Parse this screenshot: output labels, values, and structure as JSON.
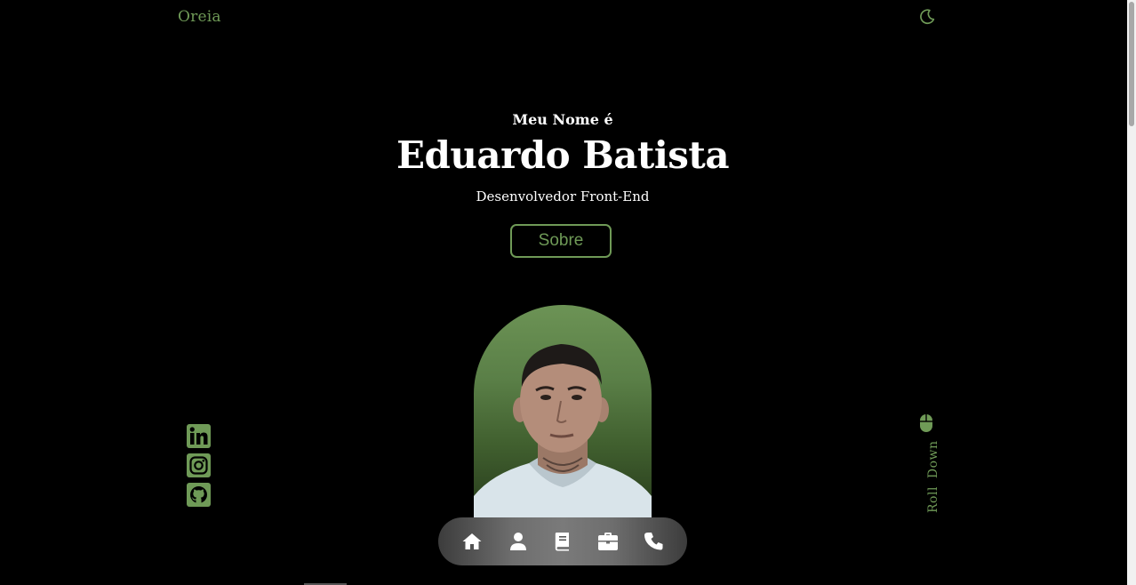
{
  "header": {
    "logo": "Oreia",
    "theme_icon": "moon-icon"
  },
  "hero": {
    "greeting": "Meu Nome é",
    "name": "Eduardo Batista",
    "role": "Desenvolvedor Front-End",
    "about_button": "Sobre"
  },
  "social": {
    "items": [
      {
        "icon": "linkedin-icon"
      },
      {
        "icon": "instagram-icon"
      },
      {
        "icon": "github-icon"
      }
    ]
  },
  "scroll": {
    "label": "Roll Down",
    "icon": "mouse-icon"
  },
  "nav": {
    "items": [
      {
        "icon": "home-icon"
      },
      {
        "icon": "user-icon"
      },
      {
        "icon": "book-icon"
      },
      {
        "icon": "briefcase-icon"
      },
      {
        "icon": "phone-icon"
      }
    ]
  },
  "colors": {
    "accent": "#6f9a57",
    "background": "#000000",
    "text": "#ffffff"
  }
}
